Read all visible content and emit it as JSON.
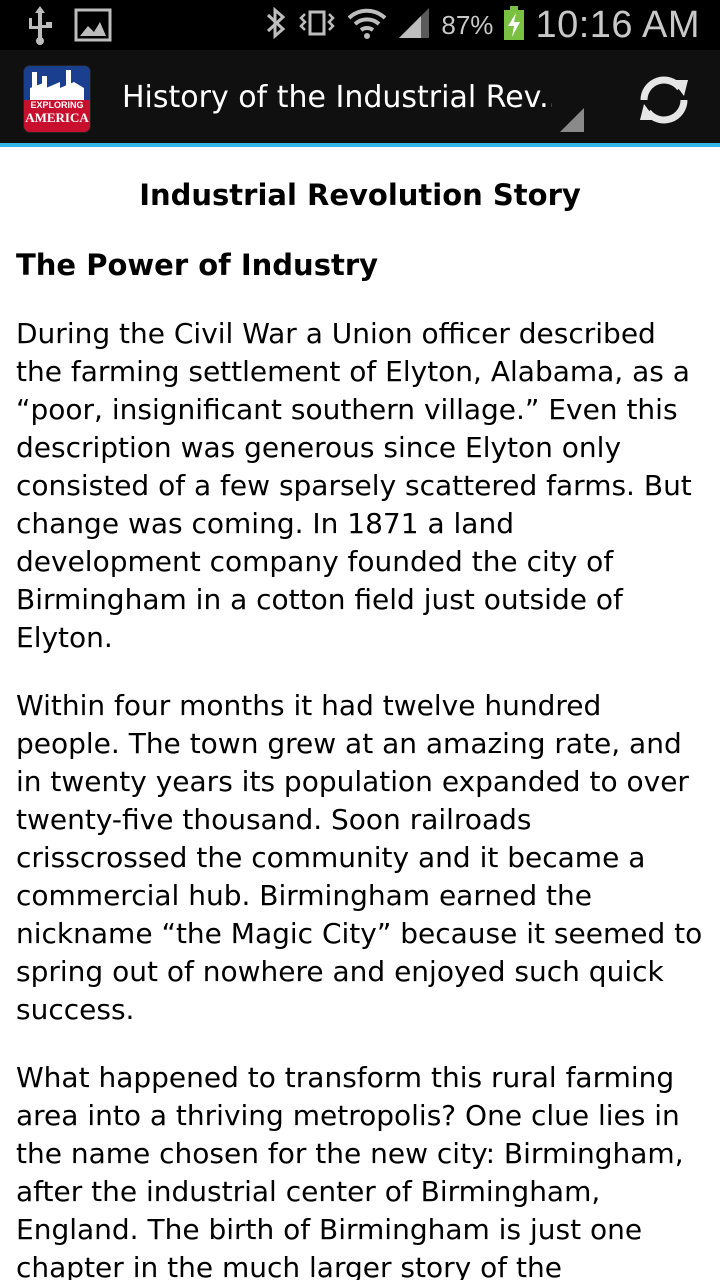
{
  "status_bar": {
    "battery_percent": "87%",
    "time": "10:16 AM",
    "icons": [
      "usb-icon",
      "image-icon",
      "bluetooth-icon",
      "vibrate-icon",
      "wifi-icon",
      "signal-icon",
      "battery-charging-icon"
    ]
  },
  "action_bar": {
    "app_icon_text_top": "EXPLORING",
    "app_icon_text_bottom": "AMERICA",
    "title": "History of the Industrial Rev..",
    "refresh_icon": "refresh-icon"
  },
  "article": {
    "title": "Industrial Revolution Story",
    "section_heading": "The Power of Industry",
    "paragraphs": [
      "During the Civil War a Union officer described the farming settlement of Elyton, Alabama, as a “poor, insignificant southern village.” Even this description was generous since Elyton only consisted of a few sparsely scattered farms. But change was coming. In 1871 a land development company founded the city of Birmingham in a cotton field just outside of Elyton.",
      "Within four months it had twelve hundred people. The town grew at an amazing rate, and in twenty years its population expanded to over twenty-five thousand. Soon railroads crisscrossed the community and it became a commercial hub. Birmingham earned the nickname “the Magic City” because it seemed to spring out of nowhere and enjoyed such quick success.",
      "What happened to transform this rural farming area into a thriving metropolis? One clue lies in the name chosen for the new city: Birmingham, after the industrial center of Birmingham, England. The birth of Birmingham is just one chapter in the much larger story of the"
    ]
  },
  "colors": {
    "status_bar_bg": "#000000",
    "action_bar_bg": "#101010",
    "accent_line": "#33b5e5",
    "battery_green": "#7ac142"
  }
}
